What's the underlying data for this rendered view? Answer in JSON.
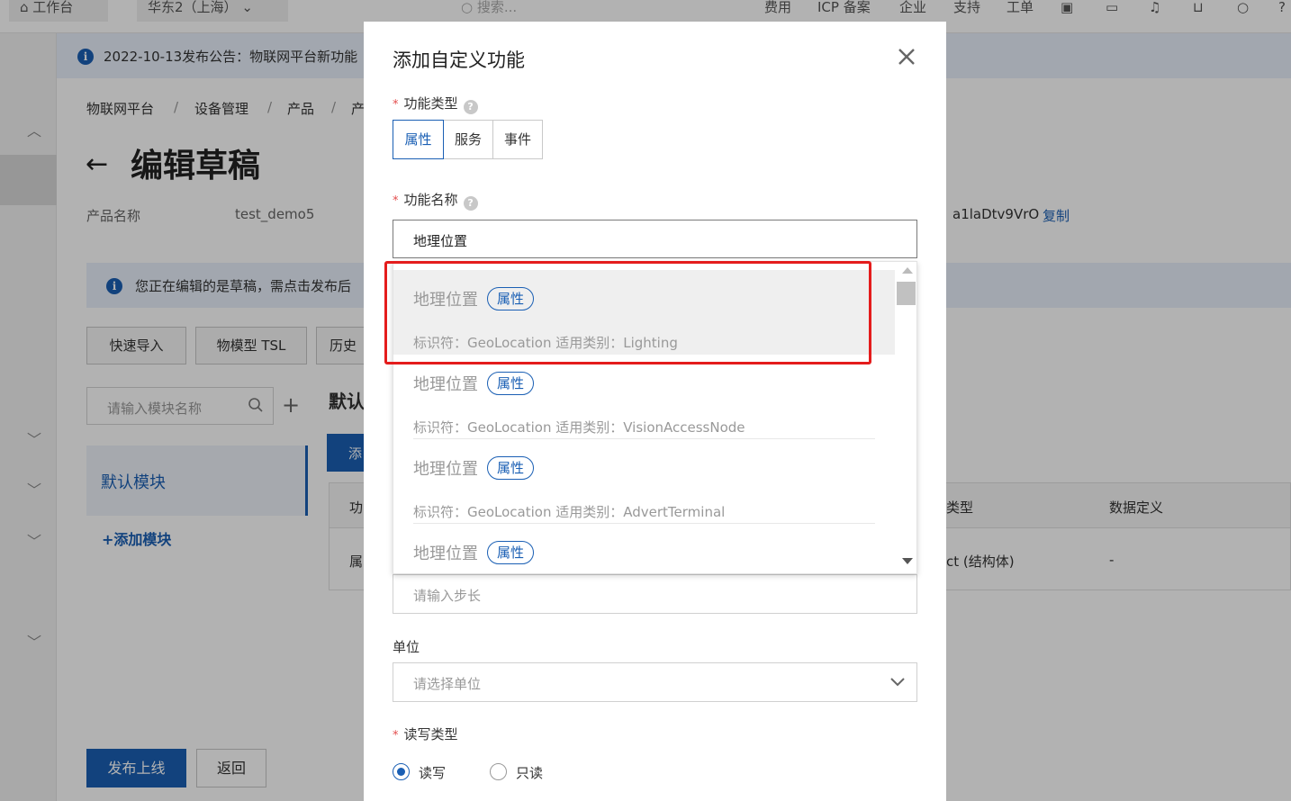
{
  "topbar": {
    "workbench": "工作台",
    "region": "华东2（上海）",
    "search_placeholder": "搜索...",
    "links": [
      "费用",
      "ICP 备案",
      "企业",
      "支持",
      "工单"
    ]
  },
  "announcement": {
    "text": "2022-10-13发布公告：物联网平台新功能"
  },
  "breadcrumb": [
    "物联网平台",
    "/",
    "设备管理",
    "/",
    "产品",
    "/",
    "产"
  ],
  "page": {
    "title": "编辑草稿",
    "product_name_label": "产品名称",
    "product_name_value": "test_demo5",
    "product_key": "a1laDtv9VrO",
    "copy_label": "复制"
  },
  "draft_notice": {
    "text": "您正在编辑的是草稿，需点击发布后"
  },
  "toolbar": {
    "quick_import": "快速导入",
    "tsl": "物模型 TSL",
    "history": "历史"
  },
  "module_panel": {
    "search_placeholder": "请输入模块名称",
    "default_module": "默认模块",
    "add_module": "+添加模块"
  },
  "feature_area": {
    "heading": "默认",
    "add_button": "添",
    "col_first": "功",
    "col_type": "类型",
    "col_def": "数据定义",
    "row_first": "属",
    "row_type": "ct (结构体)",
    "row_def": "-"
  },
  "footer": {
    "publish": "发布上线",
    "back": "返回"
  },
  "dialog": {
    "title": "添加自定义功能",
    "close_icon": "close-icon",
    "required_mark": "*",
    "help_glyph": "?",
    "type_label": "功能类型",
    "types": [
      "属性",
      "服务",
      "事件"
    ],
    "active_type": "属性",
    "name_label": "功能名称",
    "name_value": "地理位置",
    "step_placeholder": "请输入步长",
    "unit_label": "单位",
    "unit_placeholder": "请选择单位",
    "rw_label": "读写类型",
    "rw_options": [
      "读写",
      "只读"
    ],
    "rw_selected": "读写"
  },
  "suggestions": [
    {
      "name": "地理位置",
      "tag": "属性",
      "meta": "标识符：GeoLocation 适用类别：Lighting"
    },
    {
      "name": "地理位置",
      "tag": "属性",
      "meta": "标识符：GeoLocation 适用类别：VisionAccessNode"
    },
    {
      "name": "地理位置",
      "tag": "属性",
      "meta": "标识符：GeoLocation 适用类别：AdvertTerminal"
    },
    {
      "name": "地理位置",
      "tag": "属性",
      "meta": ""
    }
  ],
  "colors": {
    "accent": "#1a5fb4",
    "highlight": "#e41c1c",
    "required": "#e34d4d"
  }
}
